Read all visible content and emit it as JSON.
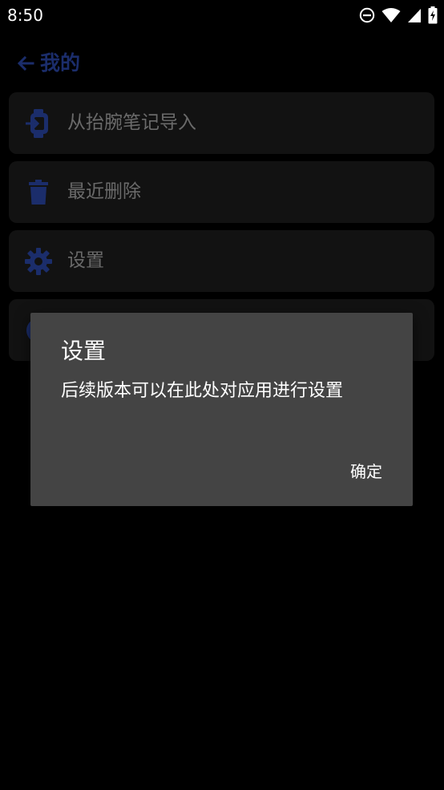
{
  "status_bar": {
    "time": "8:50",
    "icons": [
      "do-not-disturb-icon",
      "wifi-icon",
      "cell-signal-icon",
      "battery-charging-icon"
    ]
  },
  "header": {
    "back_icon": "arrow-left-icon",
    "title": "我的"
  },
  "menu": {
    "items": [
      {
        "icon": "watch-import-icon",
        "label": "从抬腕笔记导入"
      },
      {
        "icon": "trash-icon",
        "label": "最近删除"
      },
      {
        "icon": "gear-icon",
        "label": "设置"
      },
      {
        "icon": "info-icon",
        "label": ""
      }
    ]
  },
  "dialog": {
    "title": "设置",
    "message": "后续版本可以在此处对应用进行设置",
    "ok_label": "确定"
  },
  "colors": {
    "background": "#000000",
    "card": "#121212",
    "accent_dimmed": "#1b2d6b",
    "menu_text_dimmed": "#6a6a6a",
    "dialog_bg": "#444444"
  }
}
